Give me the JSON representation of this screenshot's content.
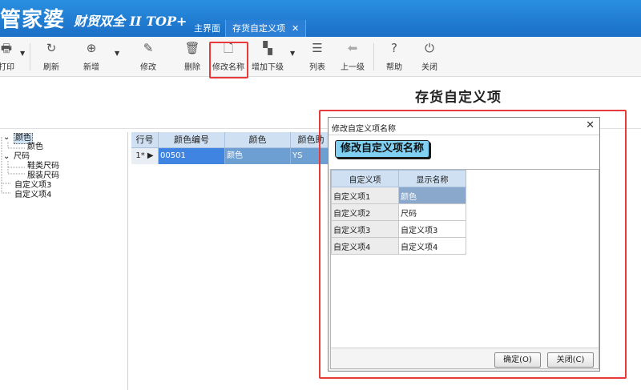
{
  "app": {
    "logo_main": "管家婆",
    "logo_sub": "财贸双全 II TOP+"
  },
  "tabs": [
    {
      "label": "主界面"
    },
    {
      "label": "存货自定义项"
    }
  ],
  "toolbar": {
    "print": {
      "label": "打印",
      "icon": "print-icon"
    },
    "refresh": {
      "label": "刷新",
      "icon": "refresh-icon"
    },
    "add": {
      "label": "新增",
      "icon": "plus-circle-icon"
    },
    "edit": {
      "label": "修改",
      "icon": "edit-icon"
    },
    "delete": {
      "label": "删除",
      "icon": "trash-icon"
    },
    "rename": {
      "label": "修改名称",
      "icon": "document-icon"
    },
    "add_sub": {
      "label": "增加下级",
      "icon": "hierarchy-icon"
    },
    "list": {
      "label": "列表",
      "icon": "list-icon"
    },
    "up_level": {
      "label": "上一级",
      "icon": "arrow-left-icon"
    },
    "help": {
      "label": "帮助",
      "icon": "question-icon"
    },
    "close": {
      "label": "关闭",
      "icon": "power-icon"
    }
  },
  "page": {
    "title": "存货自定义项"
  },
  "tree": {
    "nodes": [
      {
        "label": "颜色"
      },
      {
        "label": "颜色"
      },
      {
        "label": "尺码"
      },
      {
        "label": "鞋类尺码"
      },
      {
        "label": "服装尺码"
      },
      {
        "label": "自定义项3"
      },
      {
        "label": "自定义项4"
      }
    ]
  },
  "grid": {
    "headers": [
      "行号",
      "颜色编号",
      "颜色",
      "颜色助"
    ],
    "rows": [
      {
        "row_num": "1*",
        "code": "00501",
        "name": "颜色",
        "helper": "YS"
      }
    ]
  },
  "dialog": {
    "title": "修改自定义项名称",
    "heading": "修改自定义项名称",
    "columns": [
      "自定义项",
      "显示名称"
    ],
    "rows": [
      {
        "key": "自定义项1",
        "value": "颜色"
      },
      {
        "key": "自定义项2",
        "value": "尺码"
      },
      {
        "key": "自定义项3",
        "value": "自定义项3"
      },
      {
        "key": "自定义项4",
        "value": "自定义项4"
      }
    ],
    "ok_label": "确定(O)",
    "close_label": "关闭(C)"
  },
  "colors": {
    "header_blue": "#1a6fc6",
    "highlight_red": "#e83a3a",
    "grid_header": "#cfe0f3",
    "selected_row": "#6e9fd2"
  }
}
